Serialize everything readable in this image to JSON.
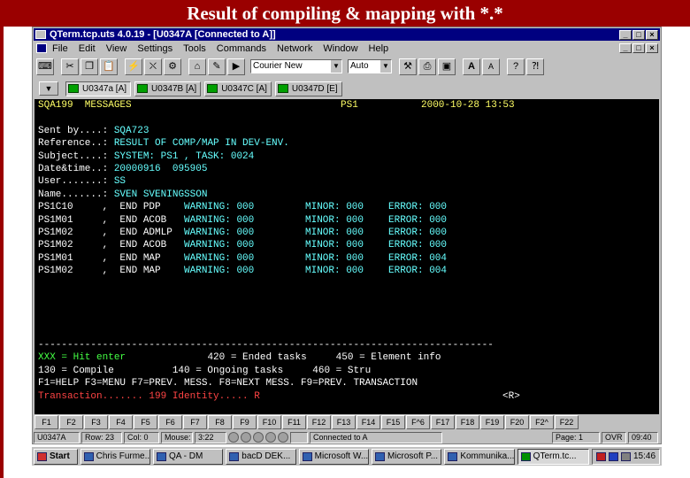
{
  "slide_title": "Result of compiling & mapping with *.*",
  "window": {
    "title": "QTerm.tcp.uts 4.0.19 - [U0347A [Connected to A]]",
    "minimize": "_",
    "maximize": "□",
    "close": "×"
  },
  "menu": [
    "File",
    "Edit",
    "View",
    "Settings",
    "Tools",
    "Commands",
    "Network",
    "Window",
    "Help"
  ],
  "toolbar": {
    "icons": [
      "keyboard-icon",
      "cut-icon",
      "copy-icon",
      "paste-icon",
      "connect-icon",
      "disconnect-icon",
      "run-icon",
      "home-icon",
      "edit-icon",
      "play-icon"
    ],
    "font_combo": "Courier New",
    "size_combo": "Auto",
    "right_icons": [
      "tools-icon",
      "print-icon",
      "save-icon",
      "font-a-icon",
      "font-aa-icon",
      "help-icon",
      "context-help-icon"
    ]
  },
  "tabs": [
    {
      "label": "U0347a [A]",
      "active": true
    },
    {
      "label": "U0347B [A]",
      "active": false
    },
    {
      "label": "U0347C [A]",
      "active": false
    },
    {
      "label": "U0347D [E]",
      "active": false
    }
  ],
  "terminal": {
    "header": {
      "left": "SQA199  MESSAGES",
      "mid": "PS1",
      "right": "2000-10-28 13:53"
    },
    "fields": [
      {
        "label": "Sent by....: ",
        "value": "SQA723"
      },
      {
        "label": "Reference..: ",
        "value": "RESULT OF COMP/MAP IN DEV-ENV."
      },
      {
        "label": "Subject....: ",
        "value": "SYSTEM: PS1 , TASK: 0024"
      },
      {
        "label": "Date&time..: ",
        "value": "20000916  095905"
      },
      {
        "label": "User.......: ",
        "value": "SS"
      },
      {
        "label": "Name.......: ",
        "value": "SVEN SVENINGSSON"
      }
    ],
    "results": [
      {
        "unit": "PS1C10     ,  END PDP    ",
        "warn": "WARNING: 000",
        "minor": "MINOR: 000",
        "error": "ERROR: 000"
      },
      {
        "unit": "PS1M01     ,  END ACOB   ",
        "warn": "WARNING: 000",
        "minor": "MINOR: 000",
        "error": "ERROR: 000"
      },
      {
        "unit": "PS1M02     ,  END ADMLP  ",
        "warn": "WARNING: 000",
        "minor": "MINOR: 000",
        "error": "ERROR: 000"
      },
      {
        "unit": "PS1M02     ,  END ACOB   ",
        "warn": "WARNING: 000",
        "minor": "MINOR: 000",
        "error": "ERROR: 000"
      },
      {
        "unit": "PS1M01     ,  END MAP    ",
        "warn": "WARNING: 000",
        "minor": "MINOR: 000",
        "error": "ERROR: 004"
      },
      {
        "unit": "PS1M02     ,  END MAP    ",
        "warn": "WARNING: 000",
        "minor": "MINOR: 000",
        "error": "ERROR: 004"
      }
    ],
    "separator": "------------------------------------------------------------------------------",
    "help1_xxx": "XXX = Hit enter",
    "help1_rest": "              420 = Ended tasks     450 = Element info",
    "help2": "130 = Compile          140 = Ongoing tasks     460 = Stru",
    "help3": "F1=HELP F3=MENU F7=PREV. MESS. F8=NEXT MESS. F9=PREV. TRANSACTION",
    "transaction_label": "Transaction....... ",
    "transaction_value": "199",
    "identity_label": " Identity..... ",
    "identity_value": "R",
    "r_indicator": "<R>"
  },
  "fkeys": [
    "F1",
    "F2",
    "F3",
    "F4",
    "F5",
    "F6",
    "F7",
    "F8",
    "F9",
    "F10",
    "F11",
    "F12",
    "F13",
    "F14",
    "F15",
    "F^6",
    "F17",
    "F18",
    "F19",
    "F20",
    "F2^",
    "F22"
  ],
  "status": {
    "session": "U0347A",
    "row": "Row: 23",
    "col": "Col: 0",
    "mouse": "Mouse:",
    "mouse_pos": "3:22",
    "connected": "Connected to A",
    "page": "Page: 1",
    "mode": "OVR",
    "time": "09:40"
  },
  "taskbar": {
    "start": "Start",
    "items": [
      "Chris Furme...",
      "QA - DM",
      "bacD DEK...",
      "Microsoft W...",
      "Microsoft P...",
      "Kommunika...",
      "QTerm.tc..."
    ],
    "active_index": 6,
    "clock": "15:46"
  }
}
